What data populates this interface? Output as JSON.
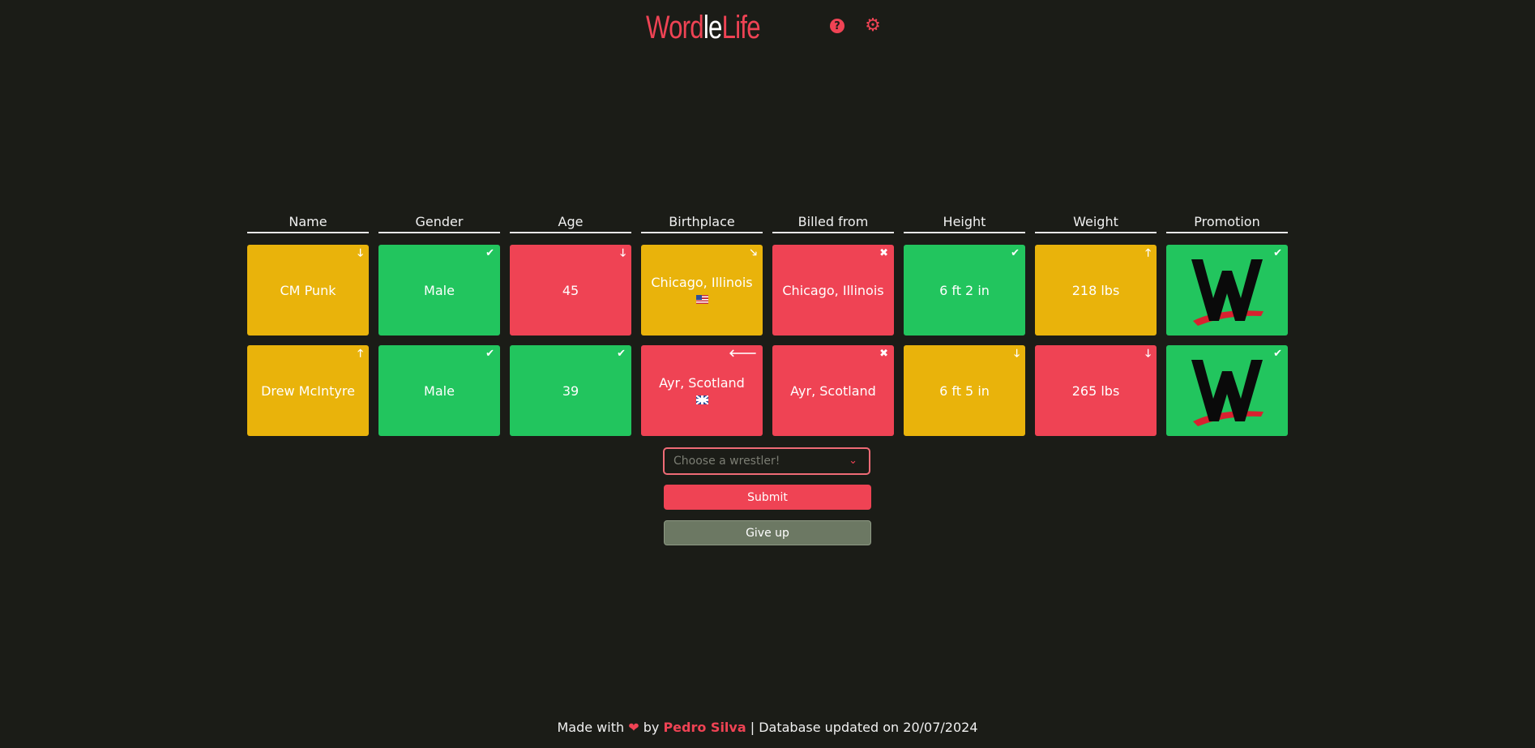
{
  "header": {
    "logo_part1": "Word",
    "logo_part2": "le",
    "logo_part3": "Life",
    "help_icon": "question-circle-icon",
    "settings_icon": "gear-icon"
  },
  "columns": [
    "Name",
    "Gender",
    "Age",
    "Birthplace",
    "Billed from",
    "Height",
    "Weight",
    "Promotion"
  ],
  "guesses": [
    {
      "name": {
        "value": "CM Punk",
        "status": "yellow",
        "hint": "arrow-down"
      },
      "gender": {
        "value": "Male",
        "status": "green",
        "hint": "check"
      },
      "age": {
        "value": "45",
        "status": "red",
        "hint": "arrow-down"
      },
      "birthplace": {
        "value": "Chicago, Illinois",
        "status": "yellow",
        "hint": "arrow-down-right",
        "flag": "us-flag-icon"
      },
      "billed_from": {
        "value": "Chicago, Illinois",
        "status": "red",
        "hint": "cross"
      },
      "height": {
        "value": "6 ft 2 in",
        "status": "green",
        "hint": "check"
      },
      "weight": {
        "value": "218 lbs",
        "status": "yellow",
        "hint": "arrow-up"
      },
      "promotion": {
        "logo": "wwe-logo",
        "status": "green",
        "hint": "check"
      }
    },
    {
      "name": {
        "value": "Drew McIntyre",
        "status": "yellow",
        "hint": "arrow-up"
      },
      "gender": {
        "value": "Male",
        "status": "green",
        "hint": "check"
      },
      "age": {
        "value": "39",
        "status": "green",
        "hint": "check"
      },
      "birthplace": {
        "value": "Ayr, Scotland",
        "status": "red",
        "hint": "arrow-left",
        "flag": "uk-flag-icon"
      },
      "billed_from": {
        "value": "Ayr, Scotland",
        "status": "red",
        "hint": "cross"
      },
      "height": {
        "value": "6 ft 5 in",
        "status": "yellow",
        "hint": "arrow-down"
      },
      "weight": {
        "value": "265 lbs",
        "status": "red",
        "hint": "arrow-down"
      },
      "promotion": {
        "logo": "wwe-logo",
        "status": "green",
        "hint": "check"
      }
    }
  ],
  "colors": {
    "yellow": "#e9b30b",
    "green": "#22c55e",
    "red": "#ef4354",
    "background": "#1b1c17",
    "give_up": "#6c7863"
  },
  "input": {
    "placeholder": "Choose a wrestler!",
    "value": ""
  },
  "buttons": {
    "submit": "Submit",
    "give_up": "Give up"
  },
  "footer": {
    "made_with": "Made with",
    "by": "by",
    "author": "Pedro Silva",
    "separator": "|",
    "database_text": "Database updated on 20/07/2024"
  }
}
